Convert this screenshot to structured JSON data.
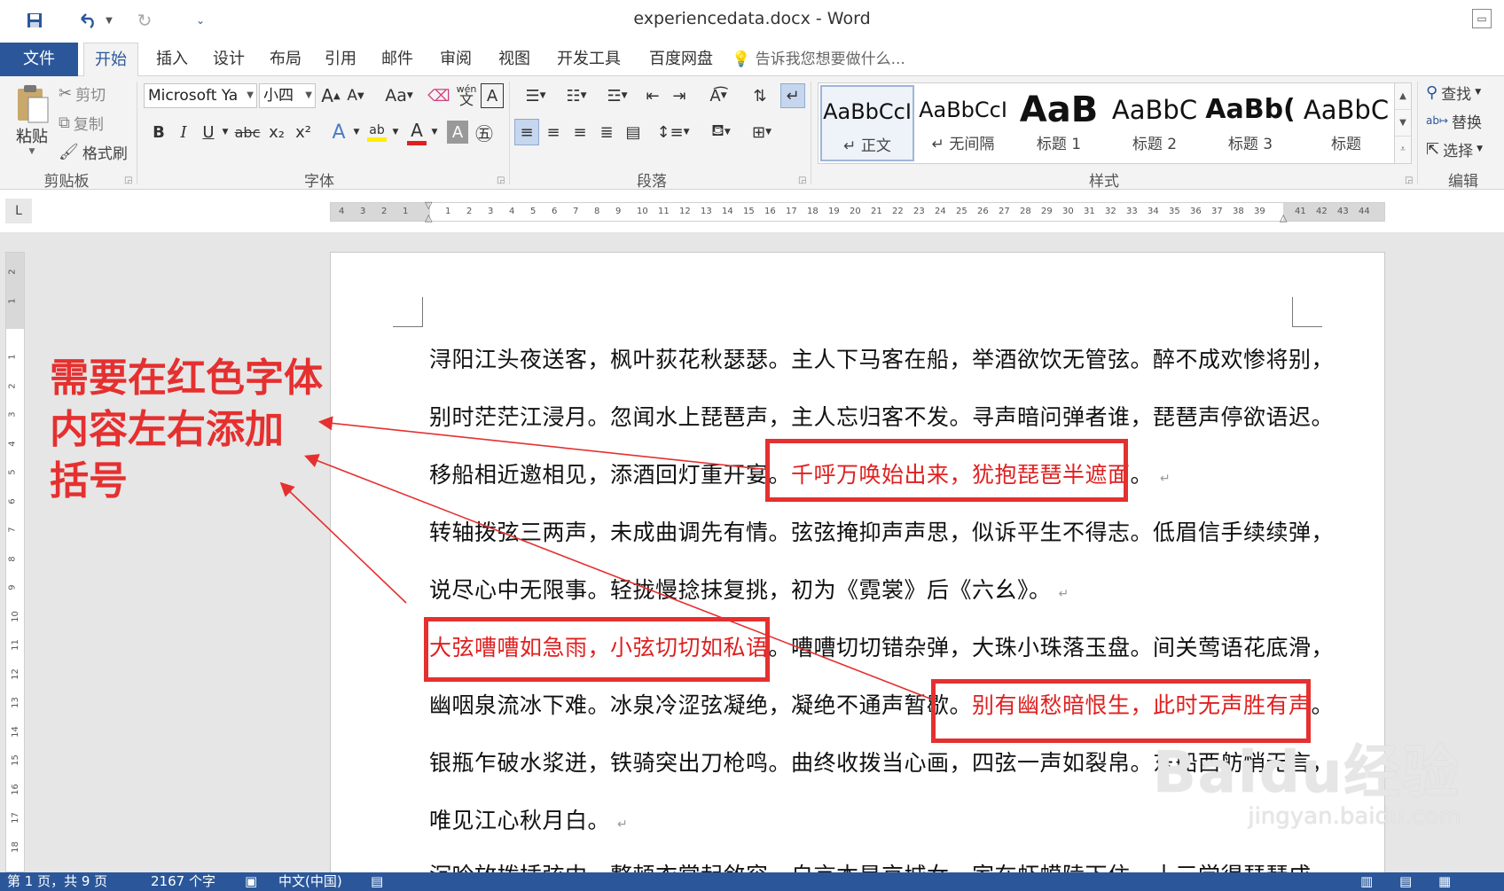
{
  "window": {
    "title": "experiencedata.docx - Word",
    "quick_access": [
      "save-icon",
      "undo-icon",
      "redo-icon",
      "customize-icon"
    ]
  },
  "tabs": [
    "文件",
    "开始",
    "插入",
    "设计",
    "布局",
    "引用",
    "邮件",
    "审阅",
    "视图",
    "开发工具",
    "百度网盘"
  ],
  "tell_me": "告诉我您想要做什么...",
  "clipboard": {
    "paste": "粘贴",
    "cut": "剪切",
    "copy": "复制",
    "format_painter": "格式刷",
    "label": "剪贴板"
  },
  "font": {
    "name": "Microsoft Ya",
    "size": "小四",
    "label": "字体",
    "grow": "A",
    "shrink": "A",
    "case": "Aa",
    "phonetic": "wén",
    "bold": "B",
    "italic": "I",
    "underline": "U",
    "strike": "abc",
    "subscript": "x₂",
    "superscript": "x²",
    "highlight": "ab",
    "color": "A"
  },
  "paragraph": {
    "label": "段落"
  },
  "styles": {
    "label": "样式",
    "items": [
      {
        "sample": "AaBbCcI",
        "name": "↵ 正文"
      },
      {
        "sample": "AaBbCcI",
        "name": "↵ 无间隔"
      },
      {
        "sample": "AaB",
        "name": "标题 1"
      },
      {
        "sample": "AaBbC",
        "name": "标题 2"
      },
      {
        "sample": "AaBb(",
        "name": "标题 3"
      },
      {
        "sample": "AaBbC",
        "name": "标题"
      }
    ]
  },
  "editing": {
    "label": "编辑",
    "find": "查找",
    "replace": "替换",
    "select": "选择"
  },
  "ruler": {
    "corner": "L",
    "left_ticks": [
      "4",
      "3",
      "2",
      "1"
    ],
    "ticks": [
      "1",
      "2",
      "3",
      "4",
      "5",
      "6",
      "7",
      "8",
      "9",
      "10",
      "11",
      "12",
      "13",
      "14",
      "15",
      "16",
      "17",
      "18",
      "19",
      "20",
      "21",
      "22",
      "23",
      "24",
      "25",
      "26",
      "27",
      "28",
      "29",
      "30",
      "31",
      "32",
      "33",
      "34",
      "35",
      "36",
      "37",
      "38",
      "39"
    ],
    "right_ticks": [
      "41",
      "42",
      "43",
      "44"
    ],
    "vertical_top": [
      "2",
      "1"
    ],
    "vertical": [
      "1",
      "2",
      "3",
      "4",
      "5",
      "6",
      "7",
      "8",
      "9",
      "10",
      "11",
      "12",
      "13",
      "14",
      "15",
      "16",
      "17",
      "18"
    ]
  },
  "document": {
    "lines": [
      {
        "text": "浔阳江头夜送客，枫叶荻花秋瑟瑟。主人下马客在船，举酒欲饮无管弦。醉不成欢惨将别，",
        "red": "",
        "after": "",
        "mark": ""
      },
      {
        "text": "别时茫茫江浸月。忽闻水上琵琶声，主人忘归客不发。寻声暗问弹者谁，琵琶声停欲语迟。",
        "red": "",
        "after": "",
        "mark": ""
      },
      {
        "text": "移船相近邀相见，添酒回灯重开宴。",
        "red": "千呼万唤始出来，犹抱琵琶半遮面",
        "after": "。",
        "mark": "↵"
      },
      {
        "text": "转轴拨弦三两声，未成曲调先有情。弦弦掩抑声声思，似诉平生不得志。低眉信手续续弹，",
        "red": "",
        "after": "",
        "mark": ""
      },
      {
        "text": "说尽心中无限事。轻拢慢捻抹复挑，初为《霓裳》后《六幺》。",
        "red": "",
        "after": "",
        "mark": "↵"
      },
      {
        "text": "",
        "red": "大弦嘈嘈如急雨，小弦切切如私语",
        "after": "。嘈嘈切切错杂弹，大珠小珠落玉盘。间关莺语花底滑，",
        "mark": ""
      },
      {
        "text": "幽咽泉流冰下难。冰泉冷涩弦凝绝，凝绝不通声暂歇。",
        "red": "别有幽愁暗恨生，此时无声胜有声",
        "after": "。",
        "mark": ""
      },
      {
        "text": "银瓶乍破水浆迸，铁骑突出刀枪鸣。曲终收拨当心画，四弦一声如裂帛。东船西舫悄无言，",
        "red": "",
        "after": "",
        "mark": ""
      },
      {
        "text": "唯见江心秋月白。",
        "red": "",
        "after": "",
        "mark": "↵"
      },
      {
        "text": "沉吟放拨插弦中，整顿衣裳起敛容。自言本是京城女，家在虾蟆陵下住。十三学得琵琶成，",
        "red": "",
        "after": "",
        "mark": ""
      }
    ]
  },
  "annotation": {
    "text_lines": [
      "需要在红色字体",
      "内容左右添加",
      "括号"
    ],
    "color": "#e53030"
  },
  "watermark": {
    "main": "Baidu经验",
    "sub": "jingyan.baidu.com"
  },
  "status": {
    "page": "第 1 页，共 9 页",
    "words": "2167 个字",
    "language": "中文(中国)"
  },
  "colors": {
    "accent": "#2b579a",
    "highlight_red": "#e53030"
  }
}
